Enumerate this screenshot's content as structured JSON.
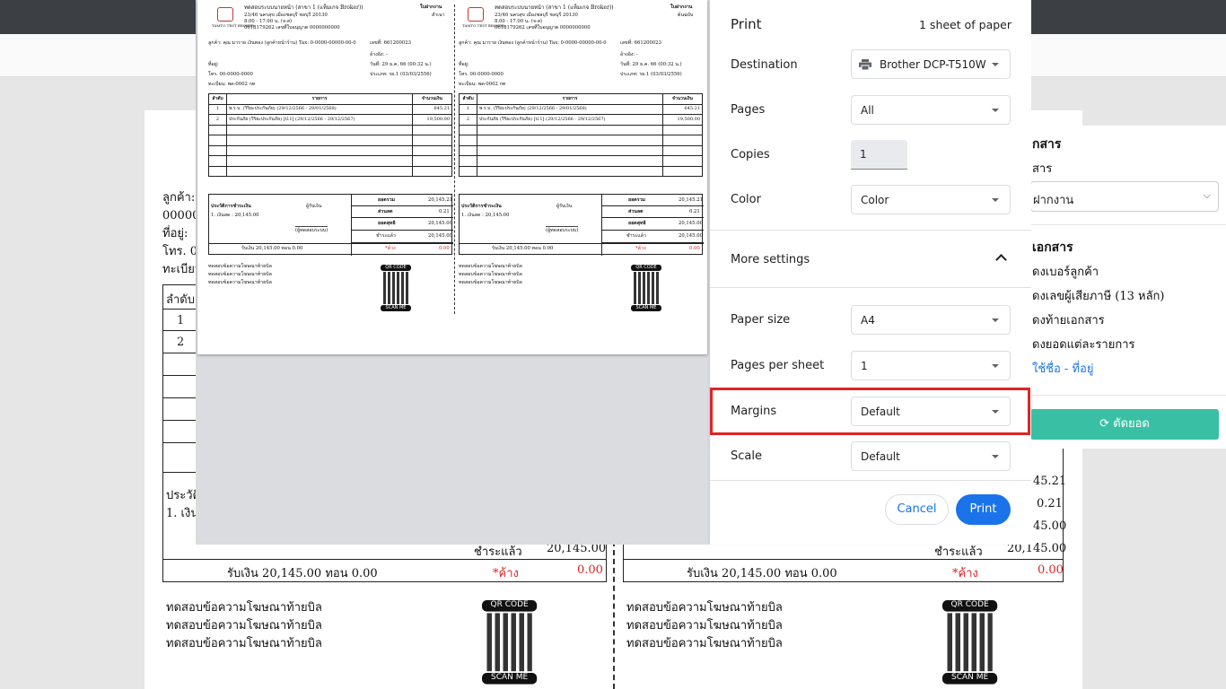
{
  "print": {
    "title": "Print",
    "sheets": "1 sheet of paper",
    "destination_label": "Destination",
    "destination_value": "Brother DCP-T510W",
    "pages_label": "Pages",
    "pages_value": "All",
    "copies_label": "Copies",
    "copies_value": "1",
    "color_label": "Color",
    "color_value": "Color",
    "more_settings": "More settings",
    "paper_size_label": "Paper size",
    "paper_size_value": "A4",
    "pps_label": "Pages per sheet",
    "pps_value": "1",
    "margins_label": "Margins",
    "margins_value": "Default",
    "scale_label": "Scale",
    "scale_value": "Default",
    "cancel": "Cancel",
    "print_btn": "Print",
    "highlight_color": "#e02424",
    "accent": "#1a73e8"
  },
  "receipt": {
    "company": "ทดสอบระบบนายหน้า (สาขา 1 (แท็มเกจ Broker))",
    "address": "23/46 นครสุข เมืองชลบุรี ชลบุรี 20130",
    "hours": "8.00 - 17.00 น. (จ-ส)",
    "phone_license": "0618179262 เลขที่ใบอนุญาต 0000000000",
    "logo_text": "TAMTO TEST BROKER",
    "doc_type_left": "ใบฝากงาน",
    "doc_sub_left": "สำเนา",
    "doc_type_right": "ใบฝากงาน",
    "doc_sub_right": "ต้นฉบับ",
    "customer": "ลูกค้า: คุณ มาราย เงินทอง (ลูกค้าหน้าร้าน) Tax: 0-0000-00000-00-0",
    "doc_no": "เลขที่: 661200023",
    "address_label": "ที่อยู่:",
    "ref": "อ้างอิง: -",
    "tel": "โทร. 00-0000-0000",
    "date": "วันที่: 29 ธ.ค. 66 (00:32 น.)",
    "plate": "ทะเบียน: พด-0002 กท",
    "type": "ประเภท: รย.1 (03/03/2556)",
    "col_no": "ลำดับ",
    "col_item": "รายการ",
    "col_amt": "จำนวนเงิน",
    "items": [
      {
        "no": "1",
        "item": "พ.ร.บ. (วิริยะประกันภัย) (29/12/2566 - 29/01/2568)",
        "amt": "645.21"
      },
      {
        "no": "2",
        "item": "ประกันภัย (วิริยะประกันภัย) [ป.1] (29/12/2566 - 29/12/2567)",
        "amt": "19,500.00"
      }
    ],
    "history_title": "ประวัติการชำระเงิน",
    "history_line": "1. เงินสด : 20,145.00",
    "receiver": "ผู้รับเงิน",
    "payer": "(ผู้ทดสอบระบบ)",
    "total_label": "ยอดรวม",
    "total": "20,145.21",
    "discount_label": "ส่วนลด",
    "discount": "0.21",
    "net_label": "ยอดสุทธิ",
    "net": "20,145.00",
    "paid_label": "ชำระแล้ว",
    "paid": "20,145.00",
    "due_label": "*ค้าง",
    "due": "0.00",
    "received": "รับเงิน 20,145.00 ทอน 0.00",
    "ad1": "ทดสอบข้อความโฆษณาท้ายบิล",
    "ad2": "ทดสอบข้อความโฆษณาท้ายบิล",
    "ad3": "ทดสอบข้อความโฆษณาท้ายบิล",
    "qr_top": "QR CODE",
    "qr_bottom": "SCAN ME"
  },
  "background": {
    "customer_frag": "ลูกค้า:",
    "zeros": "00000",
    "addr_frag": "ที่อยู่:",
    "tel_frag": "โทร. 00",
    "plate_frag": "ทะเบียน",
    "col_frag": "ลำดับ",
    "row1": "1",
    "row2": "2",
    "hist_frag": "ประวัติ",
    "cash_frag": "1. เงิน",
    "paid_label": "ชำระแล้ว",
    "paid": "20,145.00",
    "received": "รับเงิน 20,145.00 ทอน 0.00",
    "due_label": "*ค้าง",
    "due": "0.00",
    "r_total": "45.21",
    "r_disc": "0.21",
    "r_net": "45.00",
    "r_paid_label": "ชำระแล้ว",
    "r_paid": "20,145.00",
    "r_received": "รับเงิน 20,145.00 ทอน 0.00",
    "r_due_label": "*ค้าง",
    "r_due": "0.00",
    "ad": "ทดสอบข้อความโฆษณาท้ายบิล",
    "qr_top": "QR CODE",
    "qr_bottom": "SCAN ME"
  },
  "sidepanel": {
    "h1": "กสาร",
    "s1": "สาร",
    "select": "ฝากงาน",
    "h2": "เอกสาร",
    "o1": "ดงเบอร์ลูกค้า",
    "o2": "ดงเลขผู้เสียภาษี (13 หลัก)",
    "o3": "ดงท้ายเอกสาร",
    "o4": "ดงยอดแต่ละรายการ",
    "link": "ใช้ชื่อ - ที่อยู่",
    "btn": "ตัดยอด",
    "btn_color": "#39c0a4"
  }
}
